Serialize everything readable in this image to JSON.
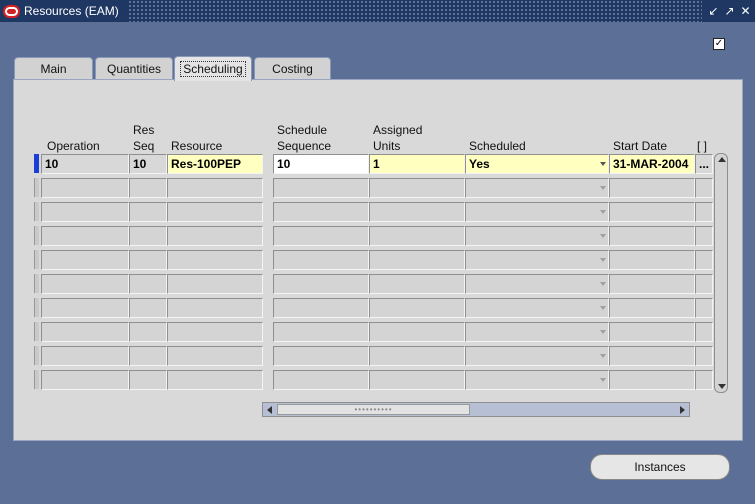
{
  "window": {
    "title": "Resources (EAM)",
    "controls": [
      "minimize-icon",
      "maximize-icon",
      "close-icon"
    ]
  },
  "tabs": [
    {
      "label": "Main",
      "active": false
    },
    {
      "label": "Quantities",
      "active": false
    },
    {
      "label": "Scheduling",
      "active": true
    },
    {
      "label": "Costing",
      "active": false
    }
  ],
  "columns": {
    "operation": "Operation",
    "res_seq_1": "Res",
    "res_seq_2": "Seq",
    "resource": "Resource",
    "schedule_sequence_1": "Schedule",
    "schedule_sequence_2": "Sequence",
    "assigned_units_1": "Assigned",
    "assigned_units_2": "Units",
    "scheduled": "Scheduled",
    "start_date": "Start Date",
    "extra": "[ ]"
  },
  "rows": [
    {
      "operation": "10",
      "res_seq": "10",
      "resource": "Res-100PEP",
      "schedule_sequence": "10",
      "assigned_units": "1",
      "scheduled": "Yes",
      "start_date": "31-MAR-2004",
      "extra": "..."
    }
  ],
  "buttons": {
    "instances": "Instances"
  },
  "colors": {
    "titlebar": "#1f3763",
    "background": "#5b6f97",
    "required_field": "#ffffc0",
    "current_row_indicator": "#1a3fd6"
  }
}
